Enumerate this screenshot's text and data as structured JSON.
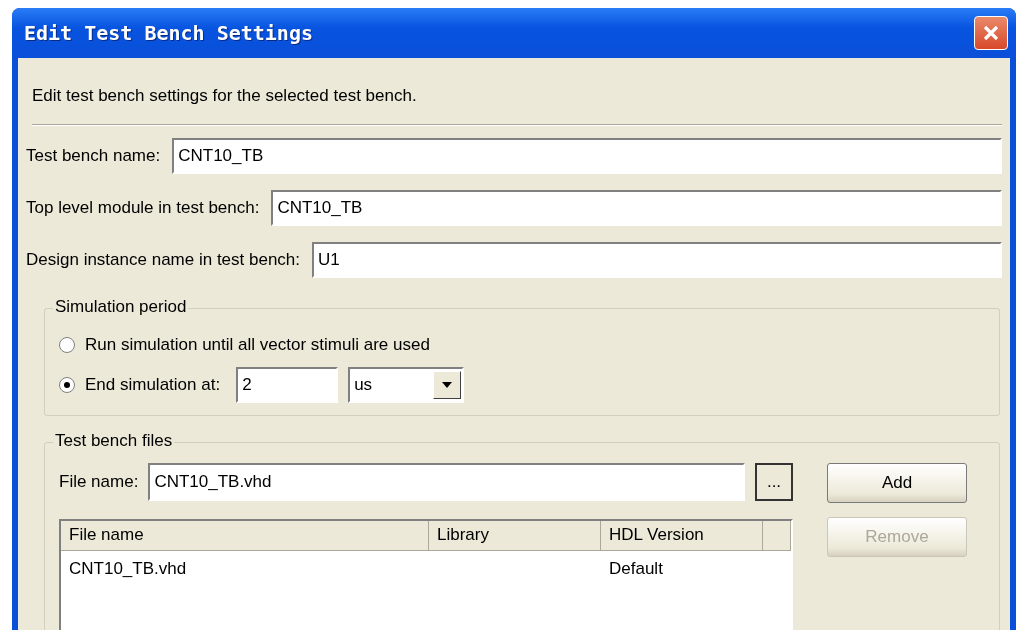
{
  "window": {
    "title": "Edit Test Bench Settings"
  },
  "description": "Edit test bench settings for the selected test bench.",
  "fields": [
    {
      "label": "Test bench name:",
      "value": "CNT10_TB"
    },
    {
      "label": "Top level module in test bench:",
      "value": "CNT10_TB"
    },
    {
      "label": "Design instance name in test bench:",
      "value": "U1"
    }
  ],
  "simulation_period": {
    "title": "Simulation period",
    "options": [
      {
        "label": "Run simulation until all vector stimuli are used",
        "selected": false
      },
      {
        "label": "End simulation at:",
        "selected": true
      }
    ],
    "end_value": "2",
    "end_unit": "us"
  },
  "test_bench_files": {
    "title": "Test bench files",
    "file_name_label": "File name:",
    "file_name": "CNT10_TB.vhd",
    "browse_label": "...",
    "columns": [
      "File name",
      "Library",
      "HDL Version"
    ],
    "rows": [
      {
        "file_name": "CNT10_TB.vhd",
        "hdl_version": "Default"
      }
    ],
    "buttons": [
      {
        "label": "Add",
        "disabled": false
      },
      {
        "label": "Remove",
        "disabled": true
      }
    ]
  }
}
